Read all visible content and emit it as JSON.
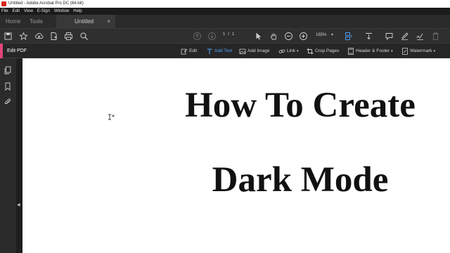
{
  "window": {
    "title": "Untitled - Adobe Acrobat Pro DC (64-bit)"
  },
  "menu": [
    "File",
    "Edit",
    "View",
    "E-Sign",
    "Window",
    "Help"
  ],
  "tabs": {
    "home": "Home",
    "tools": "Tools",
    "document": "Untitled",
    "close_glyph": "×"
  },
  "toolbar": {
    "page_current": "1",
    "page_separator": "/",
    "page_total": "1",
    "zoom": "165%",
    "zoom_caret": "▾",
    "icons": [
      "save-icon",
      "star-icon",
      "cloud-upload-icon",
      "file-export-icon",
      "print-icon",
      "search-icon",
      "page-up-icon",
      "page-down-icon",
      "select-arrow-icon",
      "hand-icon",
      "zoom-out-icon",
      "zoom-in-icon",
      "page-fit-icon",
      "scroll-icon",
      "comment-icon",
      "highlight-pen-icon",
      "sign-icon",
      "trash-icon"
    ]
  },
  "edit_toolbar": {
    "label": "Edit PDF",
    "items": [
      {
        "label": "Edit",
        "icon": "edit-icon",
        "active": false,
        "dropdown": false
      },
      {
        "label": "Add Text",
        "icon": "add-text-icon",
        "active": true,
        "dropdown": false
      },
      {
        "label": "Add Image",
        "icon": "add-image-icon",
        "active": false,
        "dropdown": false
      },
      {
        "label": "Link",
        "icon": "link-icon",
        "active": false,
        "dropdown": true
      },
      {
        "label": "Crop Pages",
        "icon": "crop-icon",
        "active": false,
        "dropdown": false
      },
      {
        "label": "Header & Footer",
        "icon": "header-footer-icon",
        "active": false,
        "dropdown": true
      },
      {
        "label": "Watermark",
        "icon": "watermark-icon",
        "active": false,
        "dropdown": true
      }
    ],
    "accent_color": "#e0457b",
    "active_color": "#4aa3ff"
  },
  "rail": {
    "icons": [
      "pages-icon",
      "bookmark-icon",
      "attachment-icon"
    ],
    "toggle_glyph": "◀"
  },
  "document": {
    "line1": "How To Create",
    "line2": "Dark Mode"
  }
}
